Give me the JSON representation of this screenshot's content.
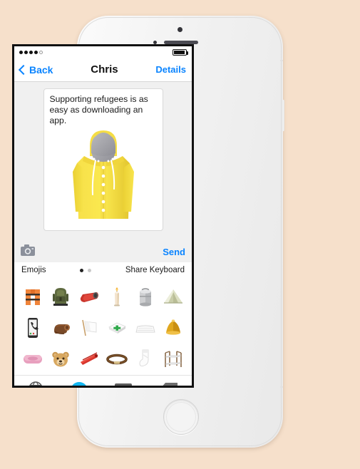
{
  "background_color": "#f6e0cb",
  "device": {
    "name": "white-iphone",
    "home_button": "home-button",
    "hardware": [
      "front-camera",
      "proximity-sensor",
      "earpiece-speaker",
      "silent-switch",
      "volume-up-button",
      "volume-down-button",
      "power-button"
    ]
  },
  "status_bar": {
    "signal_dots_filled": 4,
    "signal_dots_total": 5,
    "battery_level": "full"
  },
  "nav_bar": {
    "back_label": "Back",
    "title": "Chris",
    "details_label": "Details",
    "accent_color": "#0a84ff"
  },
  "conversation": {
    "message_text": "Supporting refugees is as easy as downloading an app.",
    "sticker": "yellow-raincoat",
    "background_color": "#f0f0f0"
  },
  "input_row": {
    "camera_icon": "camera-icon",
    "send_label": "Send"
  },
  "emoji_panel": {
    "left_label": "Emojis",
    "right_label": "Share Keyboard",
    "pages_total": 2,
    "page_active": 1,
    "rows": [
      [
        {
          "name": "life-vest",
          "glyph": "🦺"
        },
        {
          "name": "backpack",
          "glyph": "🎒"
        },
        {
          "name": "sleeping-bag",
          "glyph": "🛏"
        },
        {
          "name": "candle",
          "glyph": "🕯"
        },
        {
          "name": "water-container",
          "glyph": "🥫"
        },
        {
          "name": "tent",
          "glyph": "⛺"
        }
      ],
      [
        {
          "name": "mobile-phone",
          "glyph": "📱"
        },
        {
          "name": "rolled-mat",
          "glyph": "🧻"
        },
        {
          "name": "white-flag",
          "glyph": "🏳"
        },
        {
          "name": "first-aid-kit",
          "glyph": "💊"
        },
        {
          "name": "mattress",
          "glyph": "🛌"
        },
        {
          "name": "bell-hat",
          "glyph": "🔔"
        }
      ],
      [
        {
          "name": "soap-bar",
          "glyph": "🧼"
        },
        {
          "name": "teddy-bear",
          "glyph": "🧸"
        },
        {
          "name": "clothespin",
          "glyph": "🩹"
        },
        {
          "name": "belt",
          "glyph": "⭕"
        },
        {
          "name": "sock",
          "glyph": "🧦"
        },
        {
          "name": "bunk-bed",
          "glyph": "🪜"
        }
      ]
    ]
  },
  "keyboard_bar": {
    "globe": "globe-icon",
    "messages": "messages-bubble-icon",
    "keyboard": "keyboard-icon",
    "delete": "delete-key-icon",
    "accent_color": "#12b5f0"
  }
}
